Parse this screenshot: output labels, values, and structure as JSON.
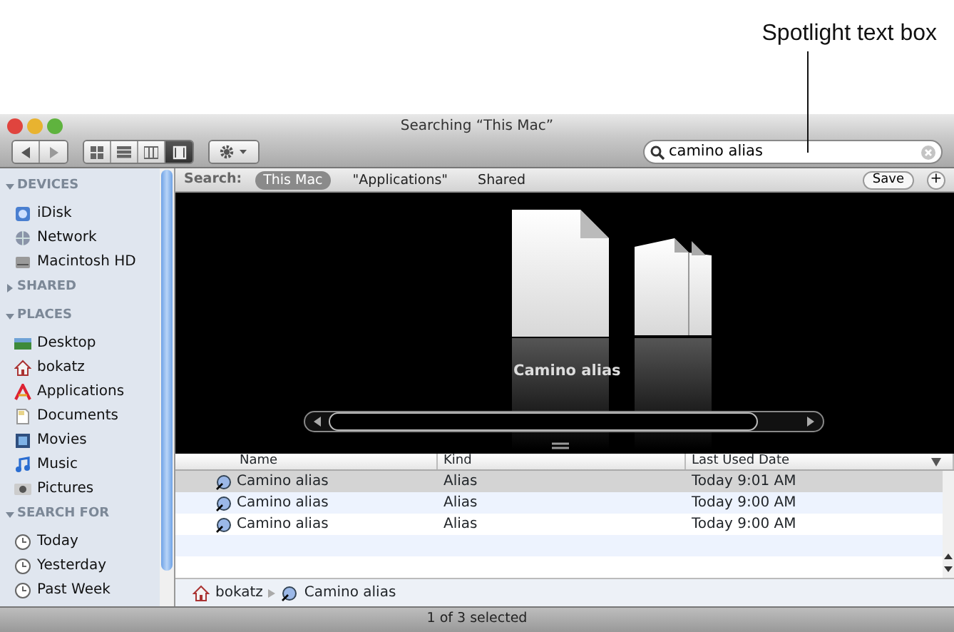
{
  "annotation": {
    "label": "Spotlight text box"
  },
  "window": {
    "title": "Searching “This Mac”"
  },
  "toolbar": {
    "view_buttons": [
      {
        "kind": "icon",
        "selected": false
      },
      {
        "kind": "list",
        "selected": false
      },
      {
        "kind": "columns",
        "selected": false
      },
      {
        "kind": "coverflow",
        "selected": true
      }
    ]
  },
  "search_field": {
    "value": "camino alias"
  },
  "search_scope": {
    "label": "Search:",
    "options": [
      {
        "label": "This Mac",
        "selected": true
      },
      {
        "label": "\"Applications\"",
        "selected": false
      },
      {
        "label": "Shared",
        "selected": false
      }
    ],
    "save_button": "Save",
    "add_button": "+"
  },
  "sidebar": {
    "sections": [
      {
        "title": "DEVICES",
        "expanded": true,
        "items": [
          {
            "label": "iDisk",
            "kind": "idisk"
          },
          {
            "label": "Network",
            "kind": "network"
          },
          {
            "label": "Macintosh HD",
            "kind": "disk"
          }
        ]
      },
      {
        "title": "SHARED",
        "expanded": false
      },
      {
        "title": "PLACES",
        "expanded": true,
        "items": [
          {
            "label": "Desktop",
            "kind": "desktop"
          },
          {
            "label": "bokatz",
            "kind": "home"
          },
          {
            "label": "Applications",
            "kind": "apps"
          },
          {
            "label": "Documents",
            "kind": "documents"
          },
          {
            "label": "Movies",
            "kind": "movies"
          },
          {
            "label": "Music",
            "kind": "music"
          },
          {
            "label": "Pictures",
            "kind": "pictures"
          }
        ]
      },
      {
        "title": "SEARCH FOR",
        "expanded": true,
        "items": [
          {
            "label": "Today",
            "kind": "clock"
          },
          {
            "label": "Yesterday",
            "kind": "clock"
          },
          {
            "label": "Past Week",
            "kind": "clock"
          }
        ]
      }
    ]
  },
  "coverflow": {
    "caption": "Camino alias"
  },
  "file_list": {
    "columns": [
      "Name",
      "Kind",
      "Last Used Date"
    ],
    "rows": [
      {
        "name": "Camino alias",
        "kind": "Alias",
        "date": "Today 9:01 AM",
        "selected": true
      },
      {
        "name": "Camino alias",
        "kind": "Alias",
        "date": "Today 9:00 AM",
        "selected": false
      },
      {
        "name": "Camino alias",
        "kind": "Alias",
        "date": "Today 9:00 AM",
        "selected": false
      }
    ]
  },
  "path_bar": [
    "bokatz",
    "Camino alias"
  ],
  "status_bar": "1 of 3 selected"
}
